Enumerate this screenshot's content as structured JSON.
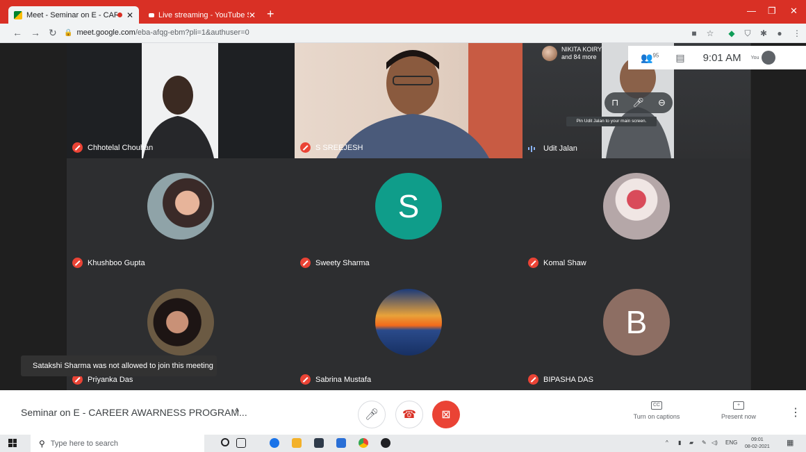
{
  "browser": {
    "tabs": [
      {
        "title": "Meet - Seminar on E - CAREE",
        "active": true
      },
      {
        "title": "Live streaming - YouTube Studio",
        "active": false
      }
    ],
    "url_host": "meet.google.com",
    "url_path": "/eba-afqg-ebm?pli=1&authuser=0"
  },
  "topbar": {
    "presenter_name": "NIKITA KOIRY",
    "presenter_more": "and 84 more",
    "participant_count": "95",
    "time": "9:01 AM",
    "you_label": "You"
  },
  "tiles": [
    {
      "name": "Chhotelal Chouhan",
      "muted": true
    },
    {
      "name": "S SREEJESH",
      "muted": true
    },
    {
      "name": "Udit Jalan",
      "muted": false
    },
    {
      "name": "Khushboo Gupta",
      "muted": true
    },
    {
      "name": "Sweety Sharma",
      "muted": true,
      "initial": "S"
    },
    {
      "name": "Komal Shaw",
      "muted": true
    },
    {
      "name": "Priyanka Das",
      "muted": true
    },
    {
      "name": "Sabrina Mustafa",
      "muted": true
    },
    {
      "name": "BIPASHA DAS",
      "muted": true,
      "initial": "B"
    }
  ],
  "tile_tooltip": "Pin Udit Jalan to your main screen.",
  "toast": "Satakshi Sharma was not allowed to join this meeting",
  "meeting": {
    "title": "Seminar on E - CAREER AWARNESS PROGRAM...",
    "captions_label": "Turn on captions",
    "present_label": "Present now"
  },
  "taskbar": {
    "search_placeholder": "Type here to search",
    "lang": "ENG",
    "time": "09:01",
    "date": "08-02-2021"
  },
  "colors": {
    "browser_red": "#d93025",
    "meet_red": "#ea4335",
    "avatar_teal": "#0f9d8a",
    "avatar_brown": "#8d6e63"
  }
}
